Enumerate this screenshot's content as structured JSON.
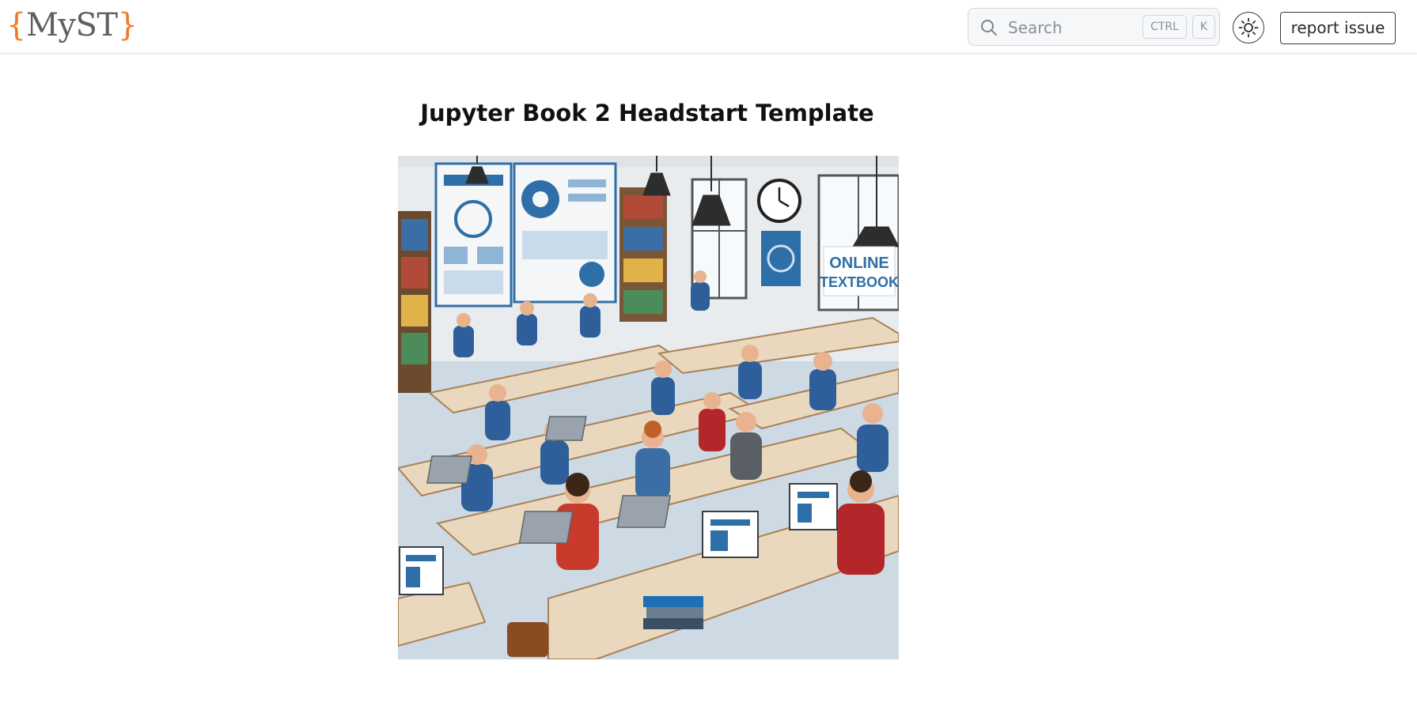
{
  "header": {
    "logo": {
      "open_brace": "{",
      "name": "MyST",
      "close_brace": "}"
    },
    "search": {
      "placeholder": "Search",
      "shortcut_modifier": "CTRL",
      "shortcut_key": "K"
    },
    "theme_toggle_icon": "sun-icon",
    "report_issue_label": "report issue"
  },
  "main": {
    "title": "Jupyter Book 2 Headstart Template",
    "hero_image": {
      "banner_text_line1": "ONLINE",
      "banner_text_line2": "TEXTBOOK"
    }
  },
  "colors": {
    "logo_brace": "#f37726",
    "logo_text": "#5f5f5f",
    "accent_blue": "#2f6fa8"
  }
}
